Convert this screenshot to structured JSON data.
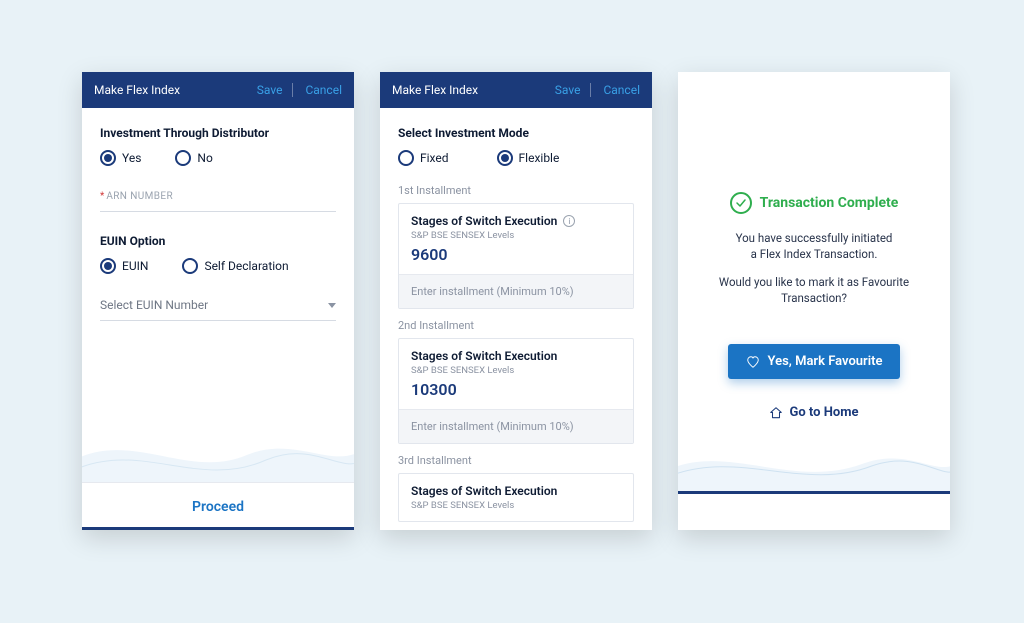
{
  "screen1": {
    "title": "Make Flex Index",
    "save": "Save",
    "cancel": "Cancel",
    "section_investment": "Investment Through Distributor",
    "radio_yes": "Yes",
    "radio_no": "No",
    "arn_placeholder": "ARN NUMBER",
    "section_euin": "EUIN Option",
    "radio_euin": "EUIN",
    "radio_self": "Self Declaration",
    "select_euin_placeholder": "Select EUIN Number",
    "proceed": "Proceed"
  },
  "screen2": {
    "title": "Make Flex Index",
    "save": "Save",
    "cancel": "Cancel",
    "section_mode": "Select Investment Mode",
    "radio_fixed": "Fixed",
    "radio_flexible": "Flexible",
    "installments": [
      {
        "caption": "1st Installment",
        "card_title": "Stages of Switch Execution",
        "card_sub": "S&P BSE SENSEX Levels",
        "value": "9600",
        "placeholder": "Enter installment (Minimum 10%)",
        "has_info": true
      },
      {
        "caption": "2nd Installment",
        "card_title": "Stages of Switch Execution",
        "card_sub": "S&P BSE SENSEX Levels",
        "value": "10300",
        "placeholder": "Enter installment (Minimum 10%)",
        "has_info": false
      },
      {
        "caption": "3rd Installment",
        "card_title": "Stages of Switch Execution",
        "card_sub": "S&P BSE SENSEX Levels",
        "value": "",
        "placeholder": "",
        "has_info": false
      }
    ]
  },
  "screen3": {
    "success_title": "Transaction Complete",
    "line1": "You have successfully initiated",
    "line2": "a Flex Index Transaction.",
    "question": "Would you like to mark it as Favourite Transaction?",
    "btn_fav": "Yes, Mark Favourite",
    "go_home": "Go to Home"
  }
}
